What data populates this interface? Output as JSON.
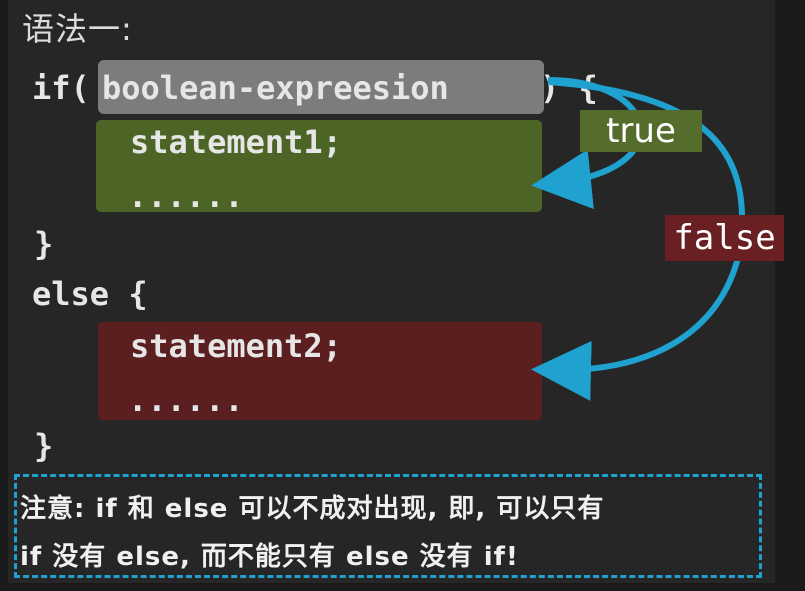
{
  "title": "语法一:",
  "code": {
    "if_keyword": "if(",
    "condition": "boolean-expreesion",
    "if_close": ") {",
    "statement1": "statement1;",
    "dots1": "......",
    "close1": "}",
    "else_line": "else {",
    "statement2": "statement2;",
    "dots2": "......",
    "close2": "}"
  },
  "labels": {
    "true": "true",
    "false": "false"
  },
  "note": {
    "line1": "注意: if 和 else 可以不成对出现, 即, 可以只有",
    "line2": "if 没有 else, 而不能只有 else 没有 if!"
  },
  "colors": {
    "condition_bg": "#7c7c7c",
    "true_bg": "#4c6426",
    "false_bg": "#5b1f1f",
    "arrow": "#1fa2d0",
    "note_border": "#1fa2d0"
  }
}
